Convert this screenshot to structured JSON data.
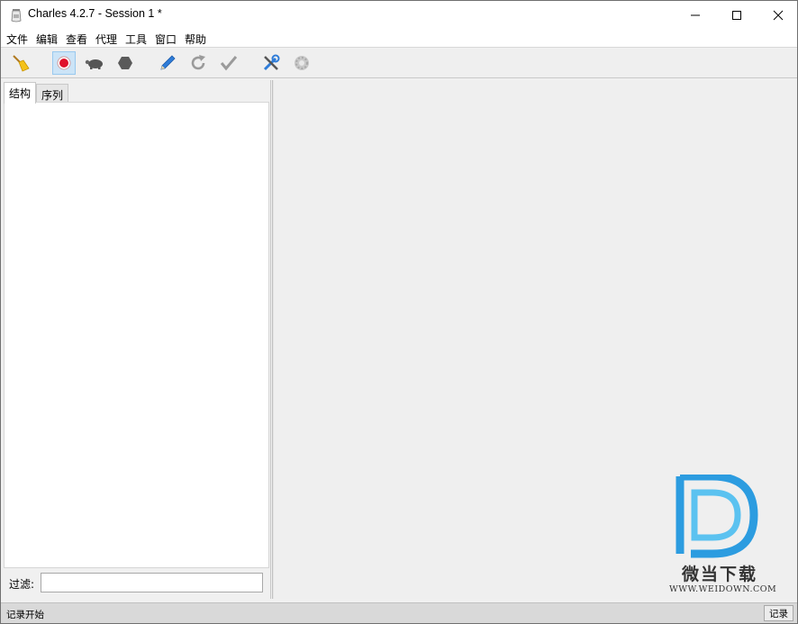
{
  "window": {
    "title": "Charles 4.2.7 - Session 1 *",
    "controls": [
      "minimize-icon",
      "maximize-icon",
      "close-icon"
    ]
  },
  "menu": {
    "items": [
      "文件",
      "编辑",
      "查看",
      "代理",
      "工具",
      "窗口",
      "帮助"
    ]
  },
  "toolbar": {
    "buttons": [
      {
        "icon": "broom-icon",
        "active": false
      },
      {
        "icon": "record-icon",
        "active": true
      },
      {
        "icon": "turtle-throttle-icon",
        "active": false
      },
      {
        "icon": "stop-hexagon-icon",
        "active": false
      },
      {
        "icon": "pen-compose-icon",
        "active": false
      },
      {
        "icon": "refresh-icon",
        "active": false
      },
      {
        "icon": "checkmark-icon",
        "active": false
      },
      {
        "icon": "tools-icon",
        "active": false
      },
      {
        "icon": "settings-gear-icon",
        "active": false
      }
    ]
  },
  "left_panel": {
    "tabs": [
      "结构",
      "序列"
    ],
    "selected_tab": "结构",
    "filter_label": "过滤:",
    "filter_value": ""
  },
  "status_bar": {
    "text": "记录开始",
    "button_label": "记录"
  },
  "watermark": {
    "name": "微当下载",
    "url": "WWW.WEIDOWN.COM",
    "colors": {
      "primary": "#2c9ce0",
      "accent": "#5bc2f0"
    }
  },
  "colors": {
    "record_red": "#e0102a",
    "active_highlight": "#cce4f7",
    "icon_gray": "#9a9a9a",
    "pen_blue": "#2e7cd8"
  }
}
